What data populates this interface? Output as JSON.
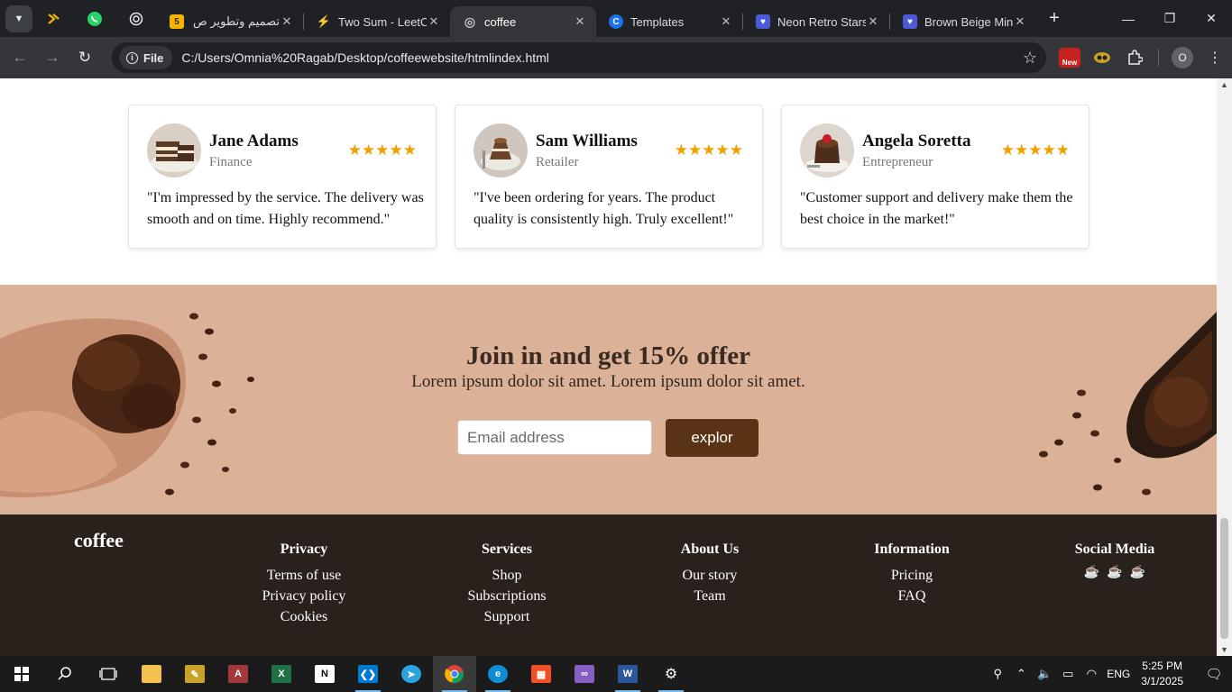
{
  "browser": {
    "tabs": [
      {
        "title": "تصميم وتطوير ص",
        "favicon_text": "5",
        "favicon_color": "#f4b400"
      },
      {
        "title": "Two Sum - LeetC",
        "favicon_text": "⚡",
        "favicon_color": "#202124"
      },
      {
        "title": "coffee",
        "favicon_text": "◎",
        "favicon_color": "#5f6368",
        "active": true
      },
      {
        "title": "Templates",
        "favicon_text": "C",
        "favicon_color": "#1a73e8"
      },
      {
        "title": "Neon Retro Stars",
        "favicon_text": "♥",
        "favicon_color": "#4b5bd8"
      },
      {
        "title": "Brown Beige Min",
        "favicon_text": "♥",
        "favicon_color": "#4b5bd8"
      }
    ],
    "address": {
      "scheme_chip": "File",
      "url": "C:/Users/Omnia%20Ragab/Desktop/coffeewebsite/htmlindex.html"
    },
    "extension_badge": "New",
    "profile_initial": "O"
  },
  "testimonials": [
    {
      "name": "Jane Adams",
      "role": "Finance",
      "rating_stars": "★★★★★",
      "rating": 5,
      "quote": "\"I'm impressed by the service. The delivery was smooth and on time. Highly recommend.\""
    },
    {
      "name": "Sam Williams",
      "role": "Retailer",
      "rating_stars": "★★★★★",
      "rating": 5,
      "quote": "\"I've been ordering for years. The product quality is consistently high. Truly excellent!\""
    },
    {
      "name": "Angela Soretta",
      "role": "Entrepreneur",
      "rating_stars": "★★★★★",
      "rating": 5,
      "quote": "\"Customer support and delivery make them the best choice in the market!\""
    }
  ],
  "offer": {
    "heading": "Join in and get 15% offer",
    "subtext": "Lorem ipsum dolor sit amet. Lorem ipsum dolor sit amet.",
    "email_placeholder": "Email address",
    "button_label": "explor"
  },
  "footer": {
    "brand": "coffee",
    "columns": [
      {
        "heading": "Privacy",
        "links": [
          "Terms of use",
          "Privacy policy",
          "Cookies"
        ]
      },
      {
        "heading": "Services",
        "links": [
          "Shop",
          "Subscriptions",
          "Support"
        ]
      },
      {
        "heading": "About Us",
        "links": [
          "Our story",
          "Team"
        ]
      },
      {
        "heading": "Information",
        "links": [
          "Pricing",
          "FAQ"
        ]
      }
    ],
    "social": {
      "heading": "Social Media",
      "icons": [
        "☕",
        "☕",
        "☕"
      ]
    }
  },
  "taskbar": {
    "language": "ENG",
    "time": "5:25 PM",
    "date": "3/1/2025"
  },
  "colors": {
    "offer_bg": "#dbb297",
    "footer_bg": "#2a211c",
    "button_bg": "#5a3314",
    "star": "#f0a000"
  }
}
